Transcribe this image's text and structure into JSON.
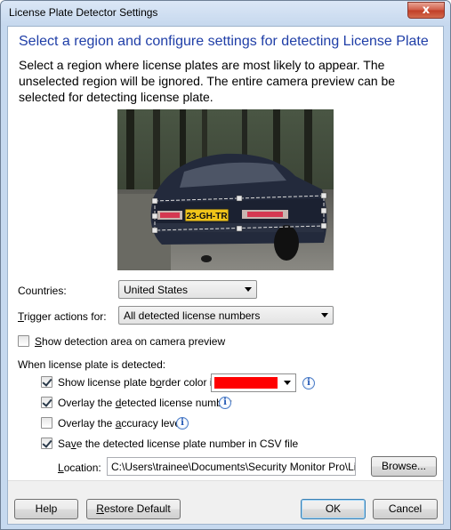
{
  "window": {
    "title": "License Plate Detector Settings",
    "close_glyph": "x"
  },
  "heading": "Select a region and configure settings for detecting License Plate",
  "description": "Select a region where license plates are most likely to appear. The unselected region will be ignored. The entire camera preview can be selected for detecting license plate.",
  "preview": {
    "plate_text": "23-GH-TR",
    "selection_color": "#dcdcdc"
  },
  "countries": {
    "label": "Countries:",
    "value": "United States"
  },
  "trigger": {
    "label_pre": "",
    "label_key": "T",
    "label_post": "rigger actions for:",
    "value": "All detected license numbers"
  },
  "show_detection": {
    "pre": "",
    "key": "S",
    "post": "how detection area on camera preview",
    "checked": false
  },
  "section_label": "When license plate is detected:",
  "options": {
    "border": {
      "pre": "Show license plate b",
      "key": "o",
      "post": "rder color in",
      "checked": true,
      "color": "#ff0000",
      "info": "i"
    },
    "overlay_number": {
      "pre": "Overlay the ",
      "key": "d",
      "post": "etected license number",
      "checked": true,
      "info": "i"
    },
    "overlay_accuracy": {
      "pre": "Overlay the ",
      "key": "a",
      "post": "ccuracy level",
      "checked": false,
      "info": "i"
    },
    "save_csv": {
      "pre": "Sa",
      "key": "v",
      "post": "e the detected license plate number in CSV file",
      "checked": true
    }
  },
  "location": {
    "pre": "",
    "key": "L",
    "post": "ocation:",
    "value": "C:\\Users\\trainee\\Documents\\Security Monitor Pro\\Licens"
  },
  "buttons": {
    "browse": "Browse...",
    "help": "Help",
    "restore_pre": "",
    "restore_key": "R",
    "restore_post": "estore Default",
    "ok": "OK",
    "cancel": "Cancel"
  }
}
